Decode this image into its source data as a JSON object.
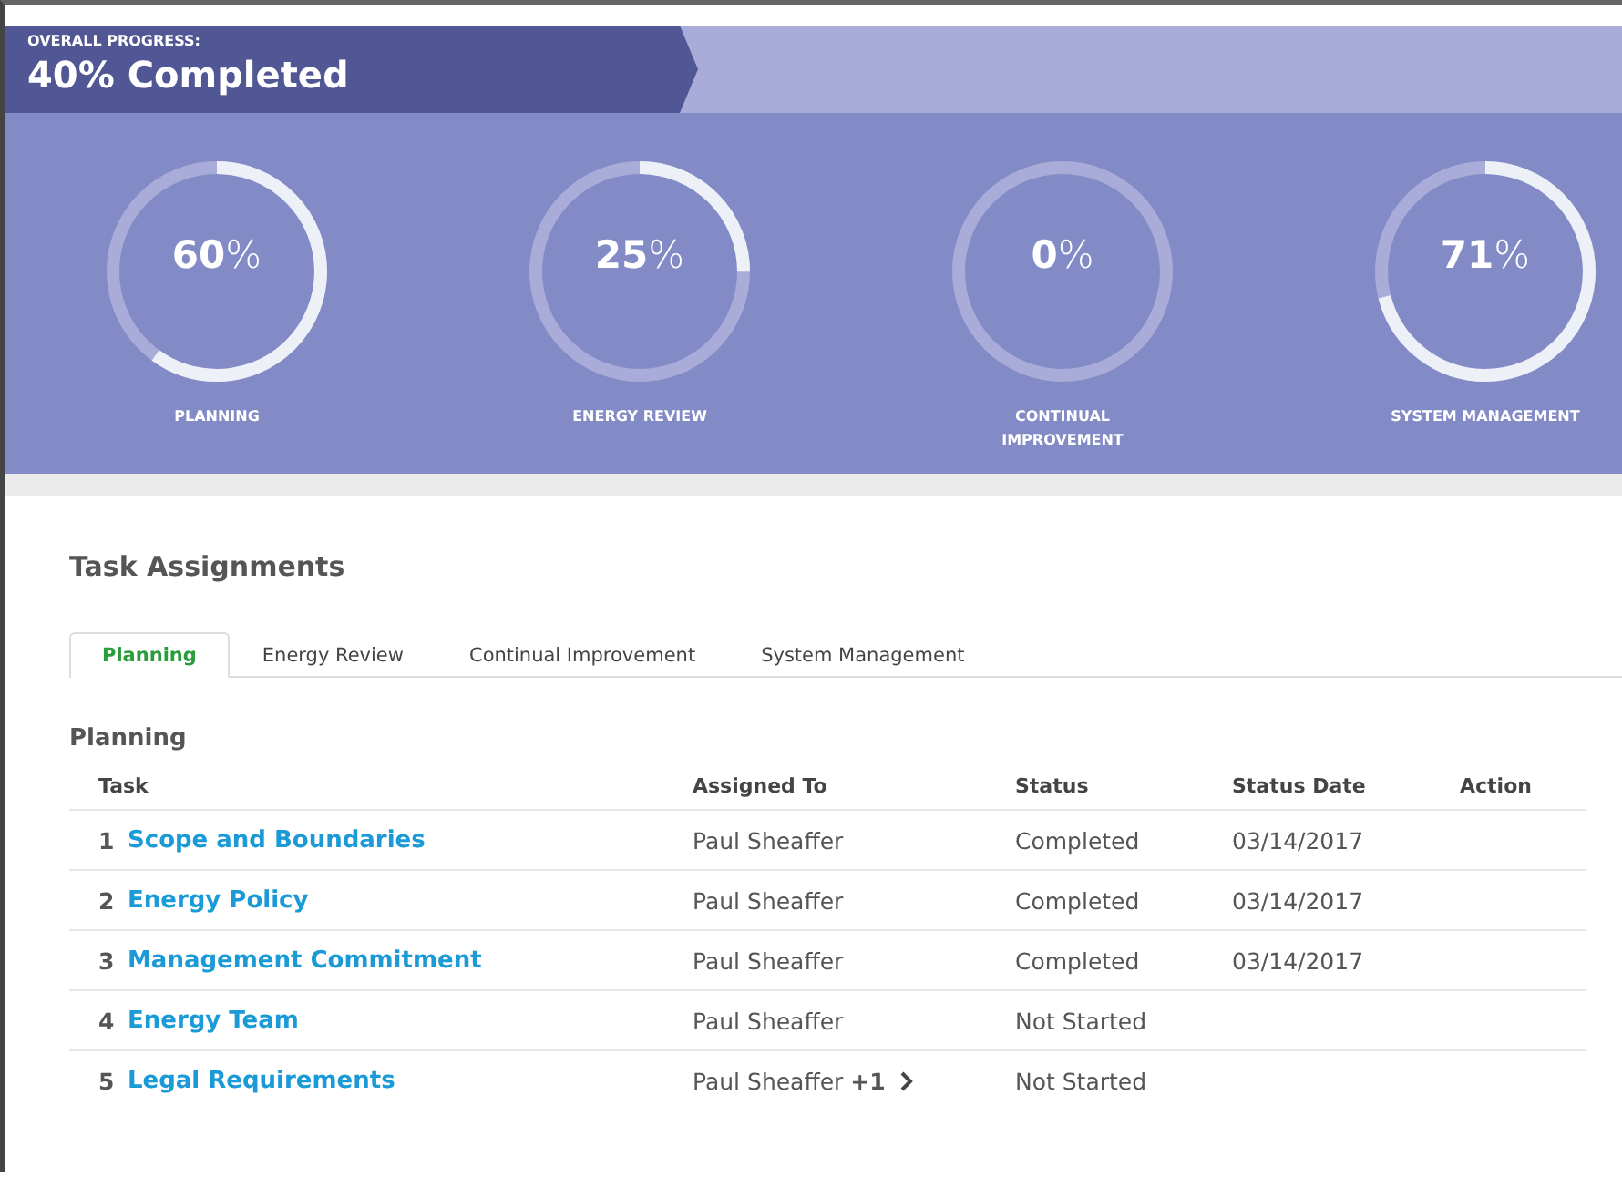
{
  "overall": {
    "label": "OVERALL PROGRESS:",
    "value": "40% Completed"
  },
  "rings": [
    {
      "value": "**60**%",
      "label": "PLANNING",
      "level": 0.6
    },
    {
      "value": "**25**%",
      "label": "ENERGY REVIEW",
      "level": 0.25
    },
    {
      "value": "**0**%",
      "label": "CONTINUAL IMPROVEMENT",
      "level": 0
    },
    {
      "value": "**71**%",
      "label": "SYSTEM MANAGEMENT",
      "level": 0.71
    }
  ],
  "section_title": "Task Assignments",
  "tabs": [
    {
      "label": "Planning",
      "selected": true
    },
    {
      "label": "Energy Review",
      "selected": false
    },
    {
      "label": "Continual Improvement",
      "selected": false
    },
    {
      "label": "System Management",
      "selected": false
    }
  ],
  "table": {
    "title": "Planning",
    "columns": [
      "Task",
      "Assigned To",
      "Status",
      "Status Date",
      "Action"
    ],
    "rows": [
      {
        "number": "1",
        "task": "Scope and Boundaries",
        "assigned": "Paul Sheaffer",
        "more": false,
        "status": "Completed",
        "date": "03/14/2017"
      },
      {
        "number": "2",
        "task": "Energy Policy",
        "assigned": "Paul Sheaffer",
        "more": false,
        "status": "Completed",
        "date": "03/14/2017"
      },
      {
        "number": "3",
        "task": "Management Commitment",
        "assigned": "Paul Sheaffer",
        "more": false,
        "status": "Completed",
        "date": "03/14/2017"
      },
      {
        "number": "4",
        "task": "Energy Team",
        "assigned": "Paul Sheaffer",
        "more": false,
        "status": "Not Started"
      },
      {
        "number": "5",
        "task": "Legal Requirements",
        "assigned": "Paul Sheaffer **+1**",
        "more": true,
        "status": "Not Started"
      }
    ]
  }
}
